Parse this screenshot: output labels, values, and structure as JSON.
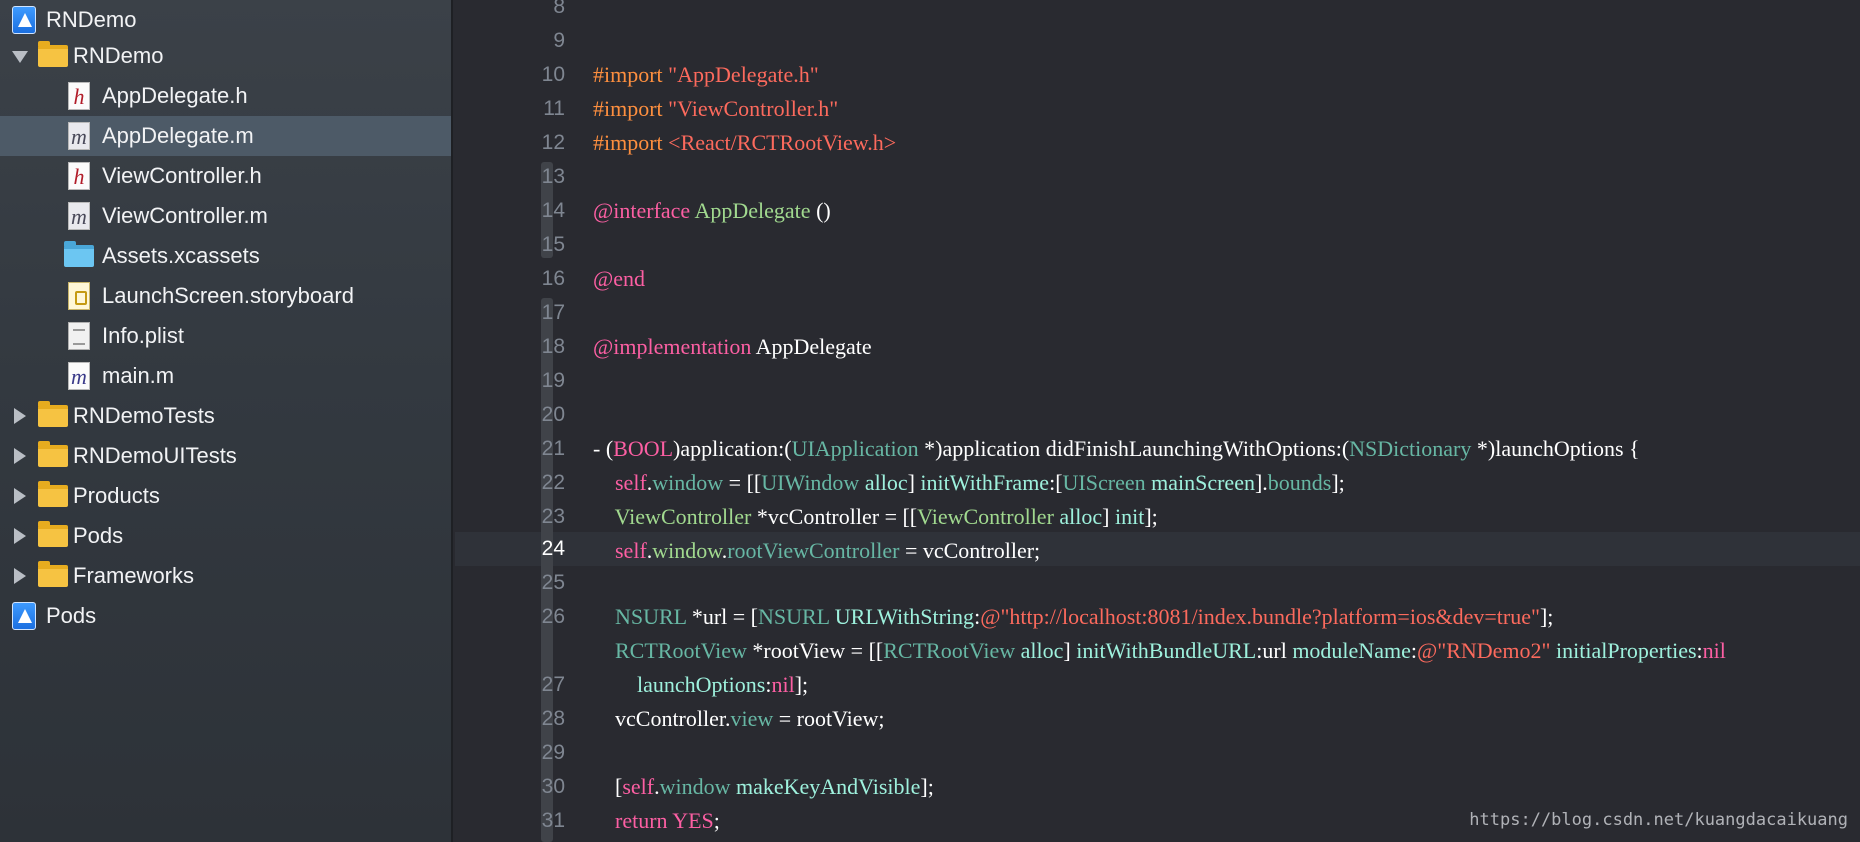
{
  "sidebar": {
    "items": [
      {
        "label": "RNDemo",
        "icon": "xcode-project-icon"
      },
      {
        "label": "RNDemo",
        "icon": "folder-icon"
      },
      {
        "label": "AppDelegate.h",
        "icon": "header-file-icon"
      },
      {
        "label": "AppDelegate.m",
        "icon": "objc-file-icon"
      },
      {
        "label": "ViewController.h",
        "icon": "header-file-icon"
      },
      {
        "label": "ViewController.m",
        "icon": "objc-file-icon"
      },
      {
        "label": "Assets.xcassets",
        "icon": "asset-catalog-icon"
      },
      {
        "label": "LaunchScreen.storyboard",
        "icon": "storyboard-icon"
      },
      {
        "label": "Info.plist",
        "icon": "plist-file-icon"
      },
      {
        "label": "main.m",
        "icon": "objc-file-icon"
      },
      {
        "label": "RNDemoTests",
        "icon": "folder-icon"
      },
      {
        "label": "RNDemoUITests",
        "icon": "folder-icon"
      },
      {
        "label": "Products",
        "icon": "folder-icon"
      },
      {
        "label": "Pods",
        "icon": "folder-icon"
      },
      {
        "label": "Frameworks",
        "icon": "folder-icon"
      },
      {
        "label": "Pods",
        "icon": "xcode-project-icon"
      }
    ],
    "selected": "AppDelegate.m"
  },
  "editor": {
    "line_numbers": [
      "8",
      "9",
      "10",
      "11",
      "12",
      "13",
      "14",
      "15",
      "16",
      "17",
      "18",
      "19",
      "20",
      "21",
      "22",
      "23",
      "24",
      "25",
      "26",
      "27",
      "28",
      "29",
      "30",
      "31"
    ],
    "current_line": "24",
    "code": {
      "l9": [
        "#import ",
        "\"AppDelegate.h\""
      ],
      "l10": [
        "#import ",
        "\"ViewController.h\""
      ],
      "l11": [
        "#import ",
        "<React/RCTRootView.h>"
      ],
      "l13": [
        "@interface",
        " ",
        "AppDelegate",
        " ()"
      ],
      "l15": [
        "@end"
      ],
      "l17": [
        "@implementation",
        " AppDelegate"
      ],
      "l20": [
        "- (",
        "BOOL",
        ")application:(",
        "UIApplication",
        " *)application didFinishLaunchingWithOptions:(",
        "NSDictionary",
        " *)launchOptions {"
      ],
      "l21": [
        "    ",
        "self",
        ".",
        "window",
        " = [[",
        "UIWindow",
        " ",
        "alloc",
        "] ",
        "initWithFrame",
        ":[",
        "UIScreen",
        " ",
        "mainScreen",
        "].",
        "bounds",
        "];"
      ],
      "l22": [
        "    ",
        "ViewController",
        " *vcController = [[",
        "ViewController",
        " ",
        "alloc",
        "] ",
        "init",
        "];"
      ],
      "l23": [
        "    ",
        "self",
        ".",
        "window",
        ".",
        "rootViewController",
        " = vcController;"
      ],
      "l25": [
        "    ",
        "NSURL",
        " *url = [",
        "NSURL",
        " ",
        "URLWithString",
        ":",
        "@\"http://localhost:8081/index.bundle?platform=ios&dev=true\"",
        "];"
      ],
      "l26": [
        "    ",
        "RCTRootView",
        " *rootView = [[",
        "RCTRootView",
        " ",
        "alloc",
        "] ",
        "initWithBundleURL",
        ":url ",
        "moduleName",
        ":",
        "@\"RNDemo2\"",
        " ",
        "initialProperties",
        ":",
        "nil"
      ],
      "l26b": [
        "        ",
        "launchOptions",
        ":",
        "nil",
        "];"
      ],
      "l27": [
        "    ",
        "vcController.",
        "view",
        " = rootView;"
      ],
      "l29": [
        "    [",
        "self",
        ".",
        "window",
        " ",
        "makeKeyAndVisible",
        "];"
      ],
      "l30": [
        "    ",
        "return",
        " ",
        "YES",
        ";"
      ],
      "l31": [
        "}"
      ]
    }
  },
  "watermark": "https://blog.csdn.net/kuangdacaikuang",
  "colors": {
    "preprocessor": "#fd8f3f",
    "string": "#fc6a5d",
    "keyword": "#fc5fa3",
    "class": "#9ef1dd",
    "project_symbol": "#a1d98f",
    "selection": "#4d5a67"
  }
}
